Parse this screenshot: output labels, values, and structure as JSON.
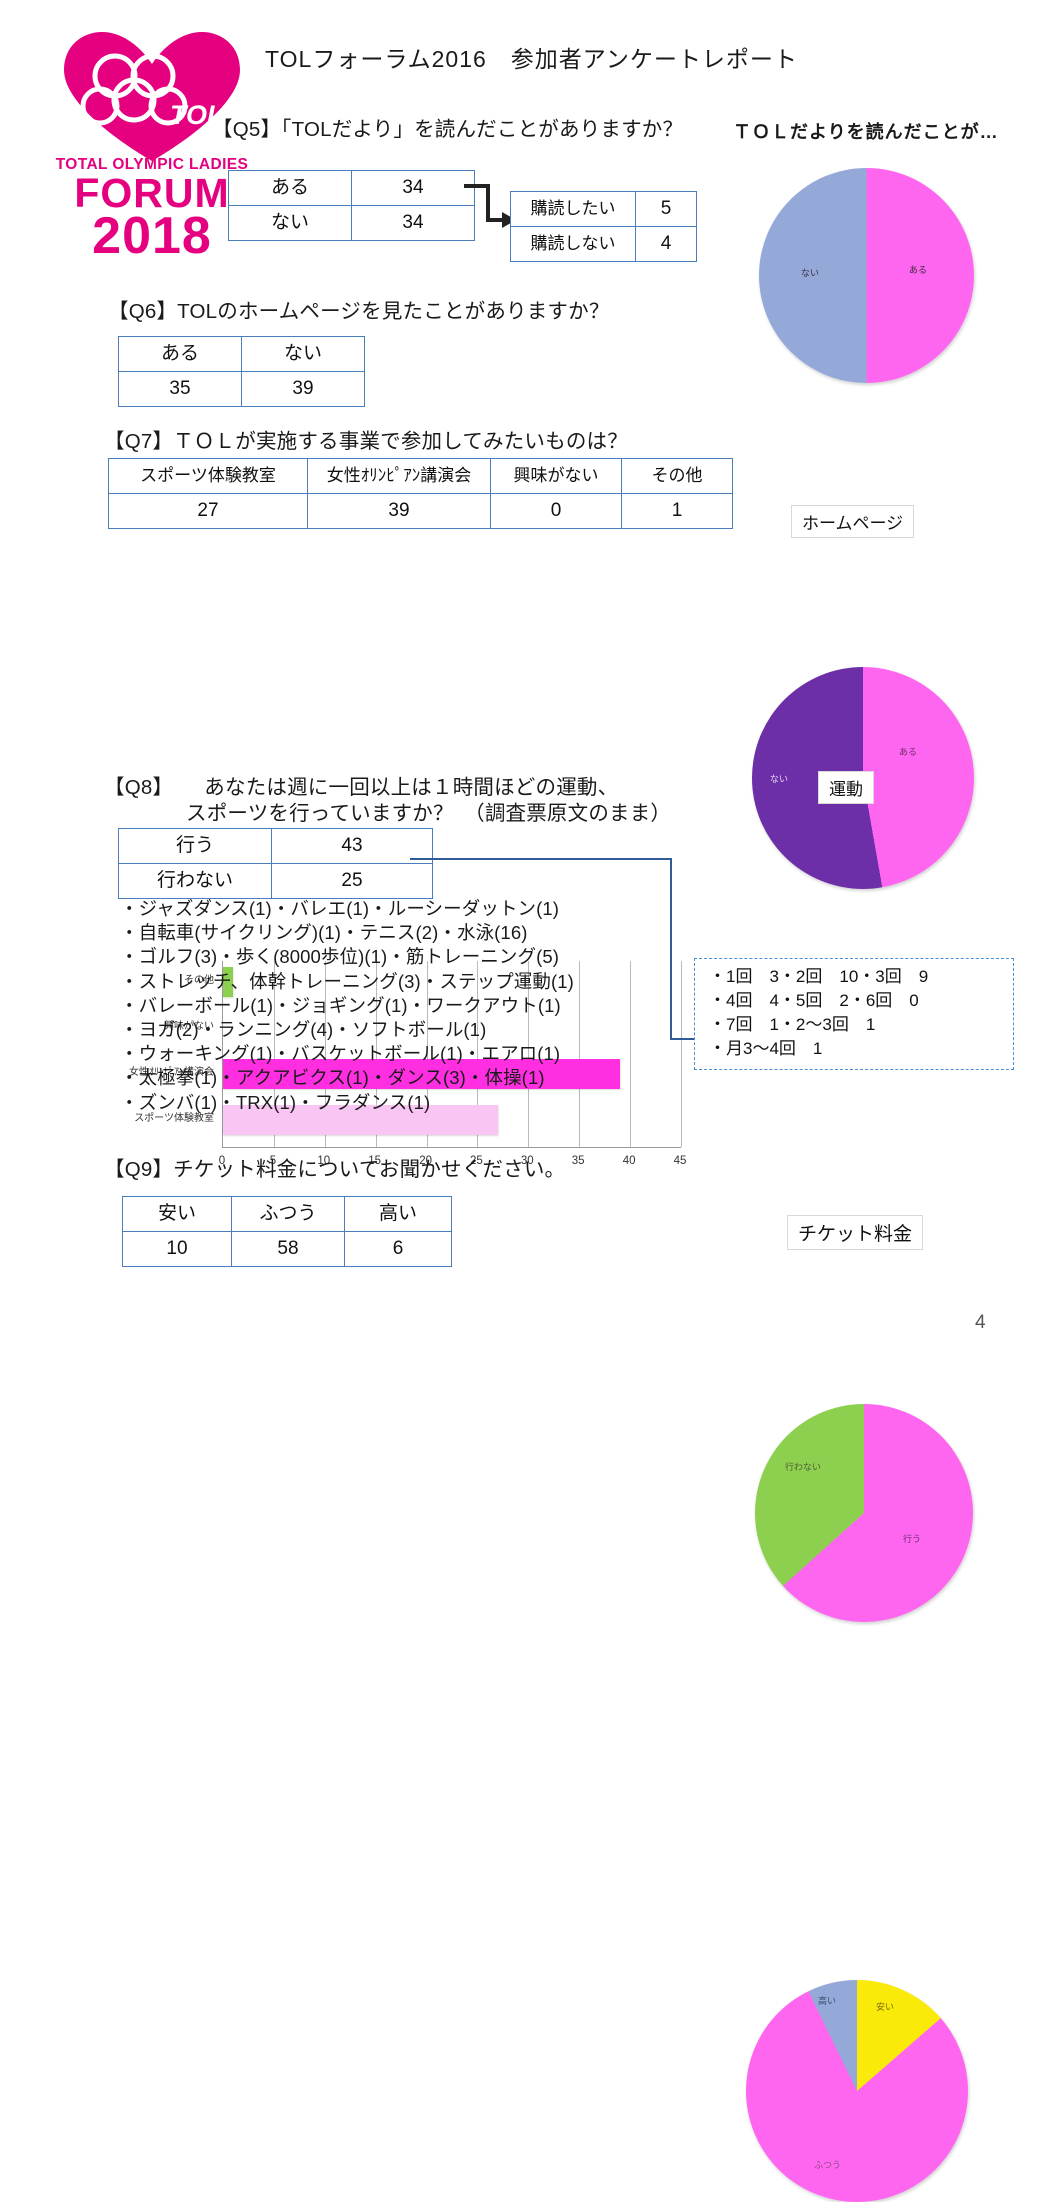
{
  "document": {
    "title": "TOLフォーラム2016　参加者アンケートレポート",
    "page_number": "4"
  },
  "logo": {
    "line1": "TOTAL OLYMPIC LADIES",
    "forum": "FORUM",
    "year": "2018",
    "mark": "TOL"
  },
  "q5": {
    "question": "【Q5】「TOLだより」を読んだことがありますか？",
    "table": {
      "rows": [
        {
          "label": "ある",
          "value": "34"
        },
        {
          "label": "ない",
          "value": "34"
        }
      ]
    },
    "sub_table": {
      "rows": [
        {
          "label": "購読したい",
          "value": "5"
        },
        {
          "label": "購読しない",
          "value": "4"
        }
      ]
    },
    "chart_title": "ＴＯＬだよりを読んだことが…"
  },
  "q6": {
    "question": "【Q6】TOLのホームページを見たことがありますか？",
    "table": {
      "headers": [
        "ある",
        "ない"
      ],
      "values": [
        "35",
        "39"
      ]
    },
    "chart_callout": "ホームページ"
  },
  "q7": {
    "question": "【Q7】ＴＯＬが実施する事業で参加してみたいものは？",
    "table": {
      "headers": [
        "スポーツ体験教室",
        "女性ｵﾘﾝﾋﾟｱﾝ講演会",
        "興味がない",
        "その他"
      ],
      "values": [
        "27",
        "39",
        "0",
        "1"
      ]
    }
  },
  "q8": {
    "question_line1": "【Q8】　　あなたは週に一回以上は１時間ほどの運動、",
    "question_line2": "スポーツを行っていますか？　（調査票原文のまま）",
    "table": {
      "rows": [
        {
          "label": "行う",
          "value": "43"
        },
        {
          "label": "行わない",
          "value": "25"
        }
      ]
    },
    "chart_callout": "運動",
    "sports_list": [
      "・ジャズダンス(1)・バレエ(1)・ルーシーダットン(1)",
      "・自転車(サイクリング)(1)・テニス(2)・水泳(16)",
      "・ゴルフ(3)・歩く(8000歩位)(1)・筋トレーニング(5)",
      "・ストレッチ、体幹トレーニング(3)・ステップ運動(1)",
      "・バレーボール(1)・ジョギング(1)・ワークアウト(1)",
      "・ヨガ(2)・ランニング(4)・ソフトボール(1)",
      "・ウォーキング(1)・バスケットボール(1)・エアロ(1)",
      "・太極拳(1)・アクアビクス(1)・ダンス(3)・体操(1)",
      "・ズンバ(1)・TRX(1)・フラダンス(1)"
    ],
    "frequency_box": [
      "・1回　3・2回　10・3回　9",
      "・4回　4・5回　2・6回　0",
      "・7回　1・2〜3回　1",
      "・月3〜4回　1"
    ]
  },
  "q9": {
    "question": "【Q9】チケット料金についてお聞かせください。",
    "table": {
      "headers": [
        "安い",
        "ふつう",
        "高い"
      ],
      "values": [
        "10",
        "58",
        "6"
      ]
    },
    "chart_callout": "チケット料金"
  },
  "colors": {
    "magenta": "#FF66F0",
    "light_pink": "#F9C6F3",
    "blue_gray": "#95A9D8",
    "purple": "#6D2FA8",
    "green": "#8DD04F",
    "yellow": "#FAEA0A",
    "table_border": "#4A7EBB",
    "brand_pink": "#E4007F"
  },
  "chart_data": [
    {
      "id": "q5-pie",
      "type": "pie",
      "title": "ＴＯＬだよりを読んだことが…",
      "labels": [
        "ある",
        "ない"
      ],
      "values": [
        34,
        34
      ],
      "colors": [
        "#FF66F0",
        "#95A9D8"
      ],
      "start_angle": 0,
      "legend": "labels-on-slices"
    },
    {
      "id": "q6-pie",
      "type": "pie",
      "title": "ホームページ",
      "labels": [
        "ある",
        "ない"
      ],
      "values": [
        35,
        39
      ],
      "colors": [
        "#FF66F0",
        "#6D2FA8"
      ],
      "start_angle": 0,
      "legend": "labels-on-slices"
    },
    {
      "id": "q7-bar",
      "type": "bar",
      "orientation": "horizontal",
      "categories": [
        "スポーツ体験教室",
        "女性ｵﾘﾝﾋﾟｱﾝ講演会",
        "興味がない",
        "その他"
      ],
      "values": [
        27,
        39,
        0,
        1
      ],
      "bar_colors": [
        "#F9C6F3",
        "#FF2EE0",
        "#FF66F0",
        "#8DD04F"
      ],
      "xlabel": "",
      "ylabel": "",
      "xlim": [
        0,
        45
      ],
      "xticks": [
        "0",
        "5",
        "10",
        "15",
        "20",
        "25",
        "30",
        "35",
        "40",
        "45"
      ],
      "grid": true
    },
    {
      "id": "q8-pie",
      "type": "pie",
      "title": "運動",
      "labels": [
        "行う",
        "行わない"
      ],
      "values": [
        43,
        25
      ],
      "colors": [
        "#FF66F0",
        "#8DD04F"
      ],
      "start_angle": 0,
      "legend": "labels-on-slices"
    },
    {
      "id": "q9-pie",
      "type": "pie",
      "title": "チケット料金",
      "labels": [
        "安い",
        "ふつう",
        "高い"
      ],
      "values": [
        10,
        58,
        6
      ],
      "colors": [
        "#FAEA0A",
        "#FF66F0",
        "#95A9D8"
      ],
      "start_angle": 0,
      "legend": "labels-on-slices"
    }
  ]
}
